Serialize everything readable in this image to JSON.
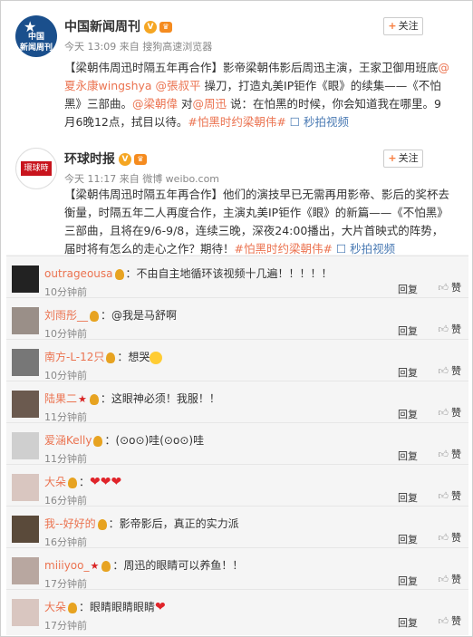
{
  "posts": [
    {
      "user": "中国新闻周刊",
      "avatar_text": [
        "中国",
        "新闻周刊"
      ],
      "meta": "今天 13:09 来自 搜狗高速浏览器",
      "follow": "关注",
      "parts": [
        {
          "t": "【梁朝伟周迅时隔五年再合作】影帝梁朝伟影后周迅主演，王家卫御用班底",
          "c": ""
        },
        {
          "t": "@夏永康wingshya",
          "c": "blue"
        },
        {
          "t": " ",
          "c": ""
        },
        {
          "t": "@張叔平",
          "c": "blue"
        },
        {
          "t": " 操刀，打造丸美IP钜作《眼》的续集——《不怕黑》三部曲。",
          "c": ""
        },
        {
          "t": "@梁朝偉",
          "c": "blue"
        },
        {
          "t": " 对",
          "c": ""
        },
        {
          "t": "@周迅",
          "c": "blue"
        },
        {
          "t": " 说：在怕黑的时候，你会知道我在哪里。9月6晚12点，拭目以待。",
          "c": ""
        },
        {
          "t": "#怕黑时约梁朝伟#",
          "c": "blue"
        },
        {
          "t": " ",
          "c": ""
        },
        {
          "t": "☐ 秒拍视频",
          "c": "link"
        }
      ]
    },
    {
      "user": "环球时报",
      "avatar_text": [
        "環球時報"
      ],
      "meta": "今天 11:17 来自 微博 weibo.com",
      "follow": "关注",
      "parts": [
        {
          "t": "【梁朝伟周迅时隔五年再合作】他们的演技早已无需再用影帝、影后的奖杯去衡量，时隔五年二人再度合作，主演丸美IP钜作《眼》的新篇——《不怕黑》三部曲，且将在9/6-9/8，连续三晚，深夜24:00播出，大片首映式的阵势，届时将有怎么的走心之作？期待！",
          "c": ""
        },
        {
          "t": "#怕黑时约梁朝伟#",
          "c": "blue"
        },
        {
          "t": " ",
          "c": ""
        },
        {
          "t": "☐ 秒拍视频",
          "c": "link"
        }
      ]
    }
  ],
  "comments": [
    {
      "name": "outrageousa",
      "text": "：不由自主地循环该视频十几遍！！！！！",
      "time": "10分钟前",
      "reply": "回复",
      "like": "赞",
      "flag": false,
      "suffix": ""
    },
    {
      "name": "刘雨彤__",
      "text": "：@我是马舒啊",
      "time": "10分钟前",
      "reply": "回复",
      "like": "赞",
      "flag": false,
      "suffix": ""
    },
    {
      "name": "南方-L-12只",
      "text": "：想哭",
      "time": "10分钟前",
      "reply": "回复",
      "like": "赞",
      "flag": false,
      "suffix": "emoji"
    },
    {
      "name": "陆果二",
      "text": "：这眼神必须！我服！！",
      "time": "11分钟前",
      "reply": "回复",
      "like": "赞",
      "flag": true,
      "suffix": ""
    },
    {
      "name": "爱涵Kelly",
      "text": "：(⊙ο⊙)哇(⊙ο⊙)哇",
      "time": "11分钟前",
      "reply": "回复",
      "like": "赞",
      "flag": false,
      "suffix": ""
    },
    {
      "name": "大朵",
      "text": "：",
      "time": "16分钟前",
      "reply": "回复",
      "like": "赞",
      "flag": false,
      "suffix": "hearts3"
    },
    {
      "name": "我--好好的",
      "text": "：影帝影后，真正的实力派",
      "time": "16分钟前",
      "reply": "回复",
      "like": "赞",
      "flag": false,
      "suffix": ""
    },
    {
      "name": "miiiyoo_",
      "text": "：周迅的眼睛可以养鱼！！",
      "time": "17分钟前",
      "reply": "回复",
      "like": "赞",
      "flag": true,
      "suffix": ""
    },
    {
      "name": "大朵",
      "text": "：眼睛眼睛眼睛",
      "time": "17分钟前",
      "reply": "回复",
      "like": "赞",
      "flag": false,
      "suffix": "heart1"
    }
  ],
  "icons": {
    "verified": "verified-icon",
    "vip": "vip-icon",
    "medal": "medal-icon",
    "flag": "flag-icon",
    "thumb": "thumbs-up-icon",
    "video": "video-icon"
  },
  "colors": {
    "name_orange": "#eb7350",
    "link_blue": "#4b7bb4",
    "brand_news": "#1a4f8c",
    "brand_global": "#c8141d"
  }
}
